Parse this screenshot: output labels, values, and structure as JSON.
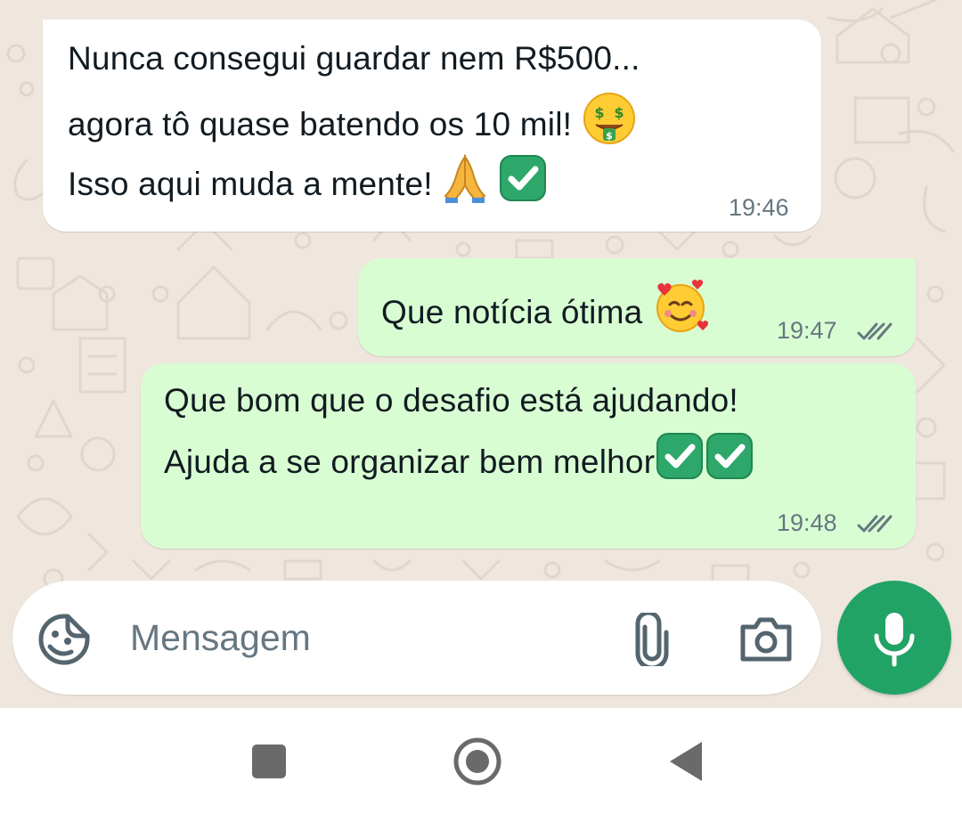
{
  "colors": {
    "chat_background": "#efe7de",
    "incoming_bubble": "#ffffff",
    "outgoing_bubble": "#d9fdd3",
    "timestamp": "#667781",
    "accent_green": "#21a366",
    "icon_gray": "#54656f"
  },
  "messages": [
    {
      "direction": "incoming",
      "lines": [
        "Nunca consegui guardar nem R$500...",
        "agora tô quase batendo os 10 mil!",
        "Isso aqui muda a mente!"
      ],
      "emojis": [
        "money-mouth-face",
        "folded-hands",
        "check-mark-button"
      ],
      "time": "19:46"
    },
    {
      "direction": "outgoing",
      "lines": [
        "Que notícia ótima"
      ],
      "emojis": [
        "smiling-face-with-hearts"
      ],
      "time": "19:47",
      "status": "read-double-check"
    },
    {
      "direction": "outgoing",
      "lines": [
        "Que bom que o desafio está ajudando!",
        "Ajuda a se organizar bem melhor"
      ],
      "emojis": [
        "check-mark-button",
        "check-mark-button"
      ],
      "time": "19:48",
      "status": "read-double-check"
    }
  ],
  "composer": {
    "placeholder": "Mensagem",
    "value": "",
    "icons": [
      "sticker-icon",
      "attach-icon",
      "camera-icon",
      "mic-icon"
    ]
  },
  "navigation_bar": {
    "icons": [
      "recent-apps-icon",
      "home-icon",
      "back-icon"
    ]
  }
}
